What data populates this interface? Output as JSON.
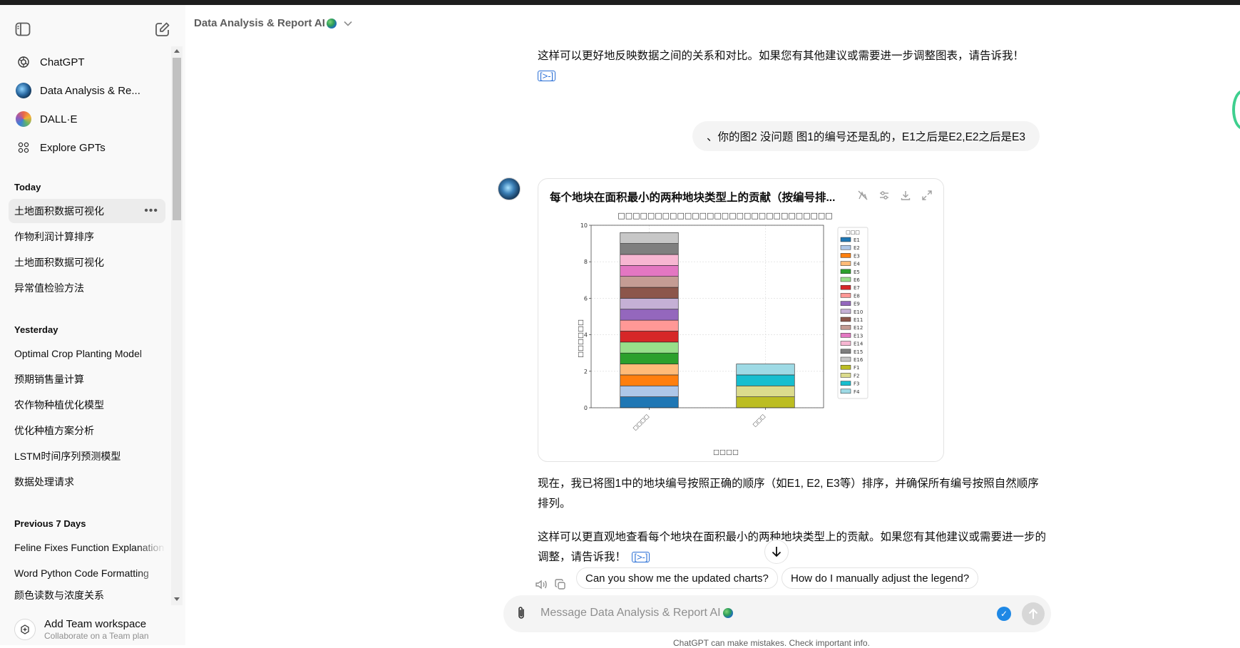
{
  "header": {
    "title": "Data Analysis & Report AI"
  },
  "sidebar": {
    "nav": [
      {
        "label": "ChatGPT",
        "icon": "openai-logo-icon"
      },
      {
        "label": "Data Analysis & Re...",
        "icon": "data-analysis-gpt-avatar"
      },
      {
        "label": "DALL·E",
        "icon": "dalle-avatar"
      },
      {
        "label": "Explore GPTs",
        "icon": "grid-icon"
      }
    ],
    "sections": [
      {
        "label": "Today",
        "items": [
          "土地面积数据可视化",
          "作物利润计算排序",
          "土地面积数据可视化",
          "异常值检验方法"
        ]
      },
      {
        "label": "Yesterday",
        "items": [
          "Optimal Crop Planting Model",
          "预期销售量计算",
          "农作物种植优化模型",
          "优化种植方案分析",
          "LSTM时间序列预测模型",
          "数据处理请求"
        ]
      },
      {
        "label": "Previous 7 Days",
        "items": [
          "Feline Fixes Function Explanation",
          "Word Python Code Formatting",
          "颜色读数与浓度关系"
        ]
      }
    ],
    "team": {
      "title": "Add Team workspace",
      "subtitle": "Collaborate on a Team plan"
    }
  },
  "chat": {
    "para_top": "这样可以更好地反映数据之间的关系和对比。如果您有其他建议或需要进一步调整图表，请告诉我！",
    "user_message": "、你的图2 没问题 图1的编号还是乱的，E1之后是E2,E2之后是E3",
    "chart_card_title": "每个地块在面积最小的两种地块类型上的贡献（按编号排...",
    "para_1": "现在，我已将图1中的地块编号按照正确的顺序（如E1, E2, E3等）排序，并确保所有编号按照自然顺序排列。",
    "para_2": "这样可以更直观地查看每个地块在面积最小的两种地块类型上的贡献。如果您有其他建议或需要进一步的调整，请告诉我！",
    "cite_label": "[>-]"
  },
  "suggestions": [
    "Can you show me the updated charts?",
    "How do I manually adjust the legend?"
  ],
  "composer": {
    "placeholder": "Message Data Analysis & Report AI"
  },
  "footer": {
    "note": "ChatGPT can make mistakes. Check important info."
  },
  "chart_data": {
    "type": "bar",
    "stacked": true,
    "title": "□□□□□□□□□□□□□□□□□□□□□□□□□□□□□",
    "xlabel": "□□□□",
    "ylabel": "□□□□□□",
    "legend_title": "□□□",
    "categories": [
      "□□□□",
      "□□□"
    ],
    "ylim": [
      0,
      10
    ],
    "yticks": [
      0,
      2,
      4,
      6,
      8,
      10
    ],
    "grid": true,
    "legend_position": "right",
    "series": [
      {
        "name": "E1",
        "color": "#1f77b4",
        "values": [
          0.6,
          0
        ]
      },
      {
        "name": "E2",
        "color": "#aec7e8",
        "values": [
          0.6,
          0
        ]
      },
      {
        "name": "E3",
        "color": "#ff7f0e",
        "values": [
          0.6,
          0
        ]
      },
      {
        "name": "E4",
        "color": "#ffbb78",
        "values": [
          0.6,
          0
        ]
      },
      {
        "name": "E5",
        "color": "#2ca02c",
        "values": [
          0.6,
          0
        ]
      },
      {
        "name": "E6",
        "color": "#98df8a",
        "values": [
          0.6,
          0
        ]
      },
      {
        "name": "E7",
        "color": "#d62728",
        "values": [
          0.6,
          0
        ]
      },
      {
        "name": "E8",
        "color": "#ff9896",
        "values": [
          0.6,
          0
        ]
      },
      {
        "name": "E9",
        "color": "#9467bd",
        "values": [
          0.6,
          0
        ]
      },
      {
        "name": "E10",
        "color": "#c5b0d5",
        "values": [
          0.6,
          0
        ]
      },
      {
        "name": "E11",
        "color": "#8c564b",
        "values": [
          0.6,
          0
        ]
      },
      {
        "name": "E12",
        "color": "#c49c94",
        "values": [
          0.6,
          0
        ]
      },
      {
        "name": "E13",
        "color": "#e377c2",
        "values": [
          0.6,
          0
        ]
      },
      {
        "name": "E14",
        "color": "#f7b6d2",
        "values": [
          0.6,
          0
        ]
      },
      {
        "name": "E15",
        "color": "#7f7f7f",
        "values": [
          0.6,
          0
        ]
      },
      {
        "name": "E16",
        "color": "#c7c7c7",
        "values": [
          0.6,
          0
        ]
      },
      {
        "name": "F1",
        "color": "#bcbd22",
        "values": [
          0,
          0.6
        ]
      },
      {
        "name": "F2",
        "color": "#dbdb8d",
        "values": [
          0,
          0.6
        ]
      },
      {
        "name": "F3",
        "color": "#17becf",
        "values": [
          0,
          0.6
        ]
      },
      {
        "name": "F4",
        "color": "#9edae5",
        "values": [
          0,
          0.6
        ]
      }
    ]
  }
}
